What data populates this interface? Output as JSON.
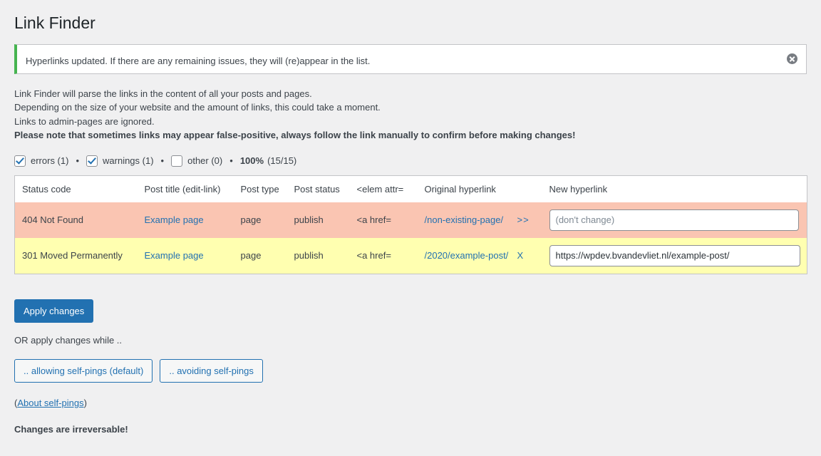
{
  "page": {
    "title": "Link Finder"
  },
  "notice": {
    "message": "Hyperlinks updated. If there are any remaining issues, they will (re)appear in the list.",
    "dismiss_icon": "close-circle-icon",
    "accent_color": "#46b450"
  },
  "intro": {
    "lines": [
      "Link Finder will parse the links in the content of all your posts and pages.",
      "Depending on the size of your website and the amount of links, this could take a moment.",
      "Links to admin-pages are ignored."
    ],
    "warning": "Please note that sometimes links may appear false-positive, always follow the link manually to confirm before making changes!"
  },
  "filters": {
    "errors": {
      "label": "errors (1)",
      "checked": true
    },
    "warnings": {
      "label": "warnings (1)",
      "checked": true
    },
    "other": {
      "label": "other (0)",
      "checked": false
    },
    "separator": "•",
    "percent": "100%",
    "progress": "(15/15)"
  },
  "table": {
    "headers": [
      "Status code",
      "Post title (edit-link)",
      "Post type",
      "Post status",
      "<elem attr=",
      "Original hyperlink",
      "",
      "New hyperlink"
    ],
    "rows": [
      {
        "status_code": "404 Not Found",
        "post_title": "Example page",
        "post_type": "page",
        "post_status": "publish",
        "elem_attr": "<a href=",
        "original_hyperlink": "/non-existing-page/",
        "arrow": ">>",
        "new_hyperlink_value": "",
        "new_hyperlink_placeholder": "(don't change)",
        "severity": "error"
      },
      {
        "status_code": "301 Moved Permanently",
        "post_title": "Example page",
        "post_type": "page",
        "post_status": "publish",
        "elem_attr": "<a href=",
        "original_hyperlink": "/2020/example-post/",
        "arrow": "X",
        "new_hyperlink_value": "https://wpdev.bvandevliet.nl/example-post/",
        "new_hyperlink_placeholder": "(don't change)",
        "severity": "warning"
      }
    ],
    "colors": {
      "error_row": "#fac5b2",
      "warning_row": "#ffffb0",
      "link": "#2271b1"
    }
  },
  "actions": {
    "apply_changes": "Apply changes",
    "or_text": "OR apply changes while ..",
    "allow_self_pings": ".. allowing self-pings (default)",
    "avoid_self_pings": ".. avoiding self-pings",
    "about_open": "(",
    "about_link": "About self-pings",
    "about_close": ")",
    "irreversible": "Changes are irreversable!"
  }
}
